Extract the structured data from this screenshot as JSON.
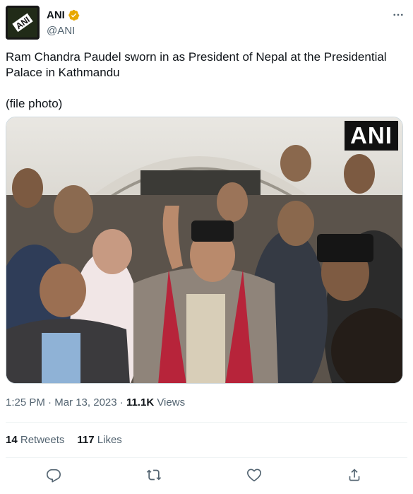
{
  "author": {
    "display_name": "ANI",
    "handle": "@ANI",
    "verified": true,
    "avatar_icon": "ani-logo-icon",
    "verified_color": "#e8a800"
  },
  "tweet": {
    "text": "Ram Chandra Paudel sworn in as President of Nepal at the Presidential Palace in Kathmandu",
    "subtext": "(file photo)",
    "photo_watermark": "ANI"
  },
  "meta": {
    "time": "1:25 PM",
    "separator1": " · ",
    "date": "Mar 13, 2023",
    "separator2": " · ",
    "views_count": "11.1K",
    "views_label": " Views"
  },
  "stats": {
    "retweets_count": "14",
    "retweets_label": "Retweets",
    "likes_count": "117",
    "likes_label": "Likes"
  },
  "actions": {
    "reply_icon": "reply-icon",
    "retweet_icon": "retweet-icon",
    "like_icon": "heart-icon",
    "share_icon": "share-icon"
  },
  "colors": {
    "text": "#0f1419",
    "secondary": "#536471",
    "divider": "#eff3f4"
  }
}
